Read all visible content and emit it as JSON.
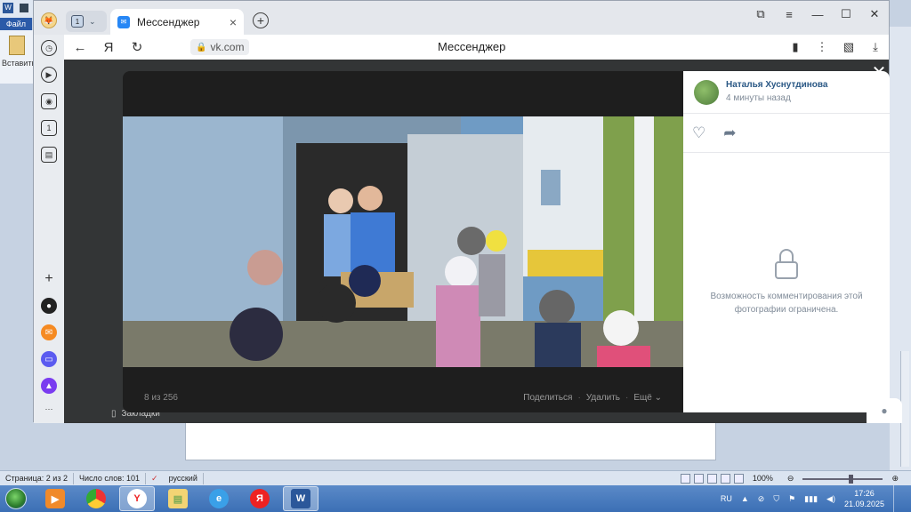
{
  "word": {
    "file_tab": "Файл",
    "paste_label": "Вставить",
    "status": {
      "page": "Страница: 2 из 2",
      "words": "Число слов: 101",
      "language": "русский",
      "zoom": "100%"
    }
  },
  "browser": {
    "tab_count": "1",
    "tab_title": "Мессенджер",
    "url": "vk.com",
    "page_title": "Мессенджер"
  },
  "background_page": {
    "bookmarks_label": "Закладки"
  },
  "viewer": {
    "counter": "8 из 256",
    "actions": [
      "Поделиться",
      "Удалить",
      "Ещё"
    ],
    "author_name": "Наталья Хуснутдинова",
    "author_time": "4 минуты назад",
    "restricted_text": "Возможность комментирования этой фотографии ограничена."
  },
  "taskbar": {
    "lang": "RU",
    "time": "17:26",
    "date": "21.09.2025"
  },
  "icons": {
    "accent_vk": "#2787f5",
    "author_link": "#2a5885"
  }
}
